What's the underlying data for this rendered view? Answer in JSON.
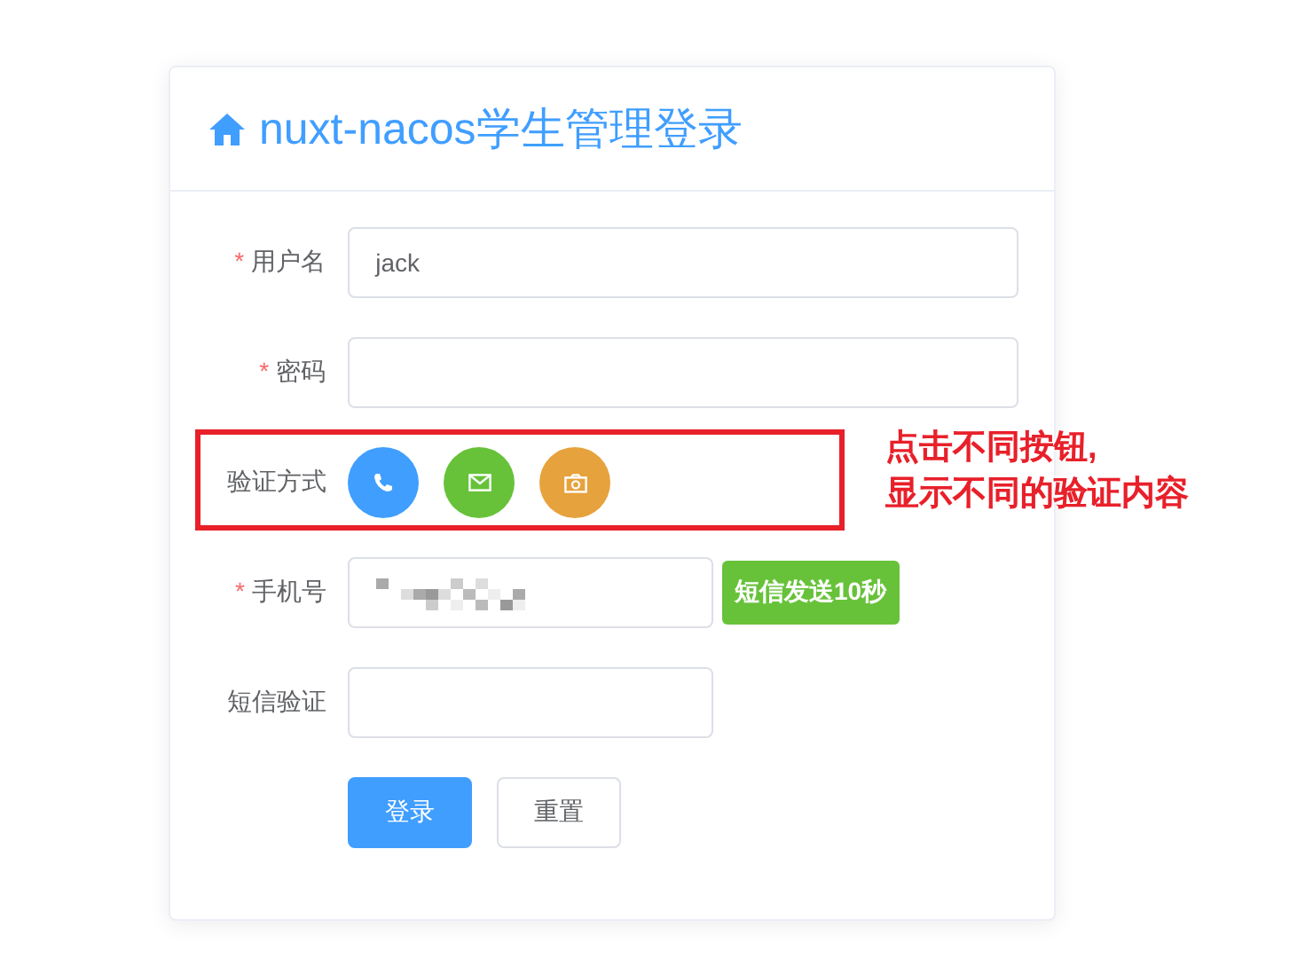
{
  "card": {
    "title": "nuxt-nacos学生管理登录",
    "fields": [
      {
        "kind": "input",
        "required_mark": "*",
        "label": "用户名",
        "value": "jack"
      },
      {
        "kind": "input",
        "required_mark": "*",
        "label": "密码"
      },
      {
        "kind": "methods",
        "label": "验证方式",
        "methods": [
          {
            "kind": "phone",
            "color": "#409eff"
          },
          {
            "kind": "mail",
            "color": "#67c23a"
          },
          {
            "kind": "camera",
            "color": "#e6a23c"
          }
        ]
      },
      {
        "kind": "sms",
        "required_mark": "*",
        "label": "手机号",
        "redacted": true,
        "button": "短信发送10秒"
      },
      {
        "kind": "input",
        "label": "短信验证",
        "narrow": true
      }
    ],
    "buttons": [
      {
        "label": "登录",
        "kind": "primary"
      },
      {
        "label": "重置",
        "kind": "plain"
      }
    ]
  },
  "annotation": {
    "lines": [
      "点击不同按钮,",
      "显示不同的验证内容"
    ]
  }
}
